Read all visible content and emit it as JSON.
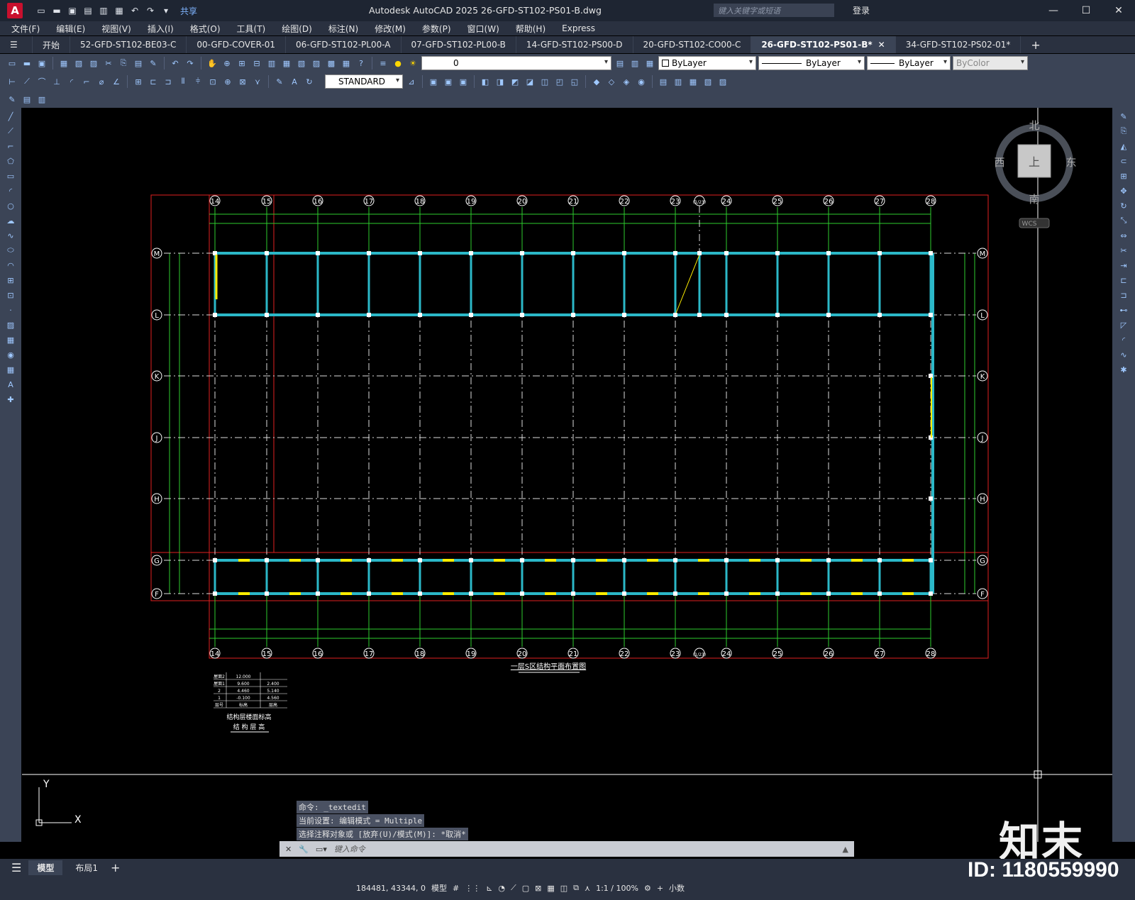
{
  "app": {
    "logo": "A",
    "title": "Autodesk AutoCAD 2025    26-GFD-ST102-PS01-B.dwg",
    "share": "共享",
    "search_placeholder": "键入关键字或短语",
    "login": "登录"
  },
  "menu": [
    "文件(F)",
    "编辑(E)",
    "视图(V)",
    "插入(I)",
    "格式(O)",
    "工具(T)",
    "绘图(D)",
    "标注(N)",
    "修改(M)",
    "参数(P)",
    "窗口(W)",
    "帮助(H)",
    "Express"
  ],
  "tabs": [
    "开始",
    "52-GFD-ST102-BE03-C",
    "00-GFD-COVER-01",
    "06-GFD-ST102-PL00-A",
    "07-GFD-ST102-PL00-B",
    "14-GFD-ST102-PS00-D",
    "20-GFD-ST102-CO00-C",
    "26-GFD-ST102-PS01-B*",
    "34-GFD-ST102-PS02-01*"
  ],
  "active_tab": "26-GFD-ST102-PS01-B*",
  "toolbar": {
    "layer_value": "0",
    "color": "ByLayer",
    "linetype": "ByLayer",
    "lineweight": "ByLayer",
    "plotstyle": "ByColor",
    "dimstyle": "STANDARD"
  },
  "viewcube": {
    "north": "北",
    "south": "南",
    "east": "东",
    "west": "西",
    "top": "上",
    "wcs": "WCS"
  },
  "drawing": {
    "columns": [
      "14",
      "15",
      "16",
      "17",
      "18",
      "19",
      "20",
      "21",
      "22",
      "23",
      "(1/23)",
      "24",
      "25",
      "26",
      "27",
      "28"
    ],
    "rows": [
      "M",
      "L",
      "K",
      "J",
      "H",
      "G",
      "F"
    ],
    "title": "一层S区结构平面布置图",
    "table_title1": "结构层楼面标高",
    "table_title2": "结 构 层 高",
    "table_rows": [
      [
        "屋面2",
        "12.000",
        ""
      ],
      [
        "屋面1",
        "9.600",
        "2.400"
      ],
      [
        "2",
        "4.460",
        "5.140"
      ],
      [
        "1",
        "-0.100",
        "4.560"
      ],
      [
        "层号",
        "标高",
        "层高"
      ]
    ]
  },
  "command": {
    "lines": [
      "命令: _textedit",
      "当前设置: 编辑模式 = Multiple",
      "选择注释对象或 [放弃(U)/模式(M)]: *取消*"
    ],
    "placeholder": "键入命令"
  },
  "layout_tabs": [
    "模型",
    "布局1"
  ],
  "status": {
    "coords": "184481, 43344, 0",
    "model": "模型",
    "scale": "1:1 / 100%",
    "units": "小数"
  },
  "watermark": {
    "logo": "知末",
    "id": "ID: 1180559990"
  },
  "colors": {
    "red": "#e02020",
    "green": "#2ecc2e",
    "cyan": "#2bb8c8",
    "yellow": "#ffee00"
  }
}
